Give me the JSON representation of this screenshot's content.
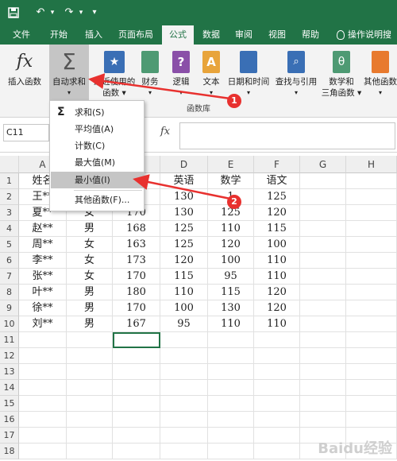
{
  "quick_access": {
    "undo": "↶",
    "redo": "↷",
    "more": "▾"
  },
  "tabs": [
    "文件",
    "开始",
    "插入",
    "页面布局",
    "公式",
    "数据",
    "审阅",
    "视图",
    "帮助"
  ],
  "active_tab": "公式",
  "tell_me": "操作说明搜",
  "ribbon": {
    "insert_function": "插入函数",
    "autosum": "自动求和",
    "recent_line1": "最近使用的",
    "recent_line2": "函数",
    "financial": "财务",
    "logical": "逻辑",
    "text": "文本",
    "datetime": "日期和时间",
    "lookup": "查找与引用",
    "math_line1": "数学和",
    "math_line2": "三角函数",
    "more": "其他函数",
    "group_label": "函数库"
  },
  "formula_bar": {
    "name_box": "C11",
    "fx": "fx"
  },
  "autosum_menu": {
    "items": [
      "求和(S)",
      "平均值(A)",
      "计数(C)",
      "最大值(M)",
      "最小值(I)",
      "其他函数(F)..."
    ],
    "highlighted": "最小值(I)"
  },
  "columns": [
    "A",
    "B",
    "C",
    "D",
    "E",
    "F",
    "G",
    "H"
  ],
  "rows": [
    "1",
    "2",
    "3",
    "4",
    "5",
    "6",
    "7",
    "8",
    "9",
    "10",
    "11",
    "12",
    "13",
    "14",
    "15",
    "16",
    "17",
    "18"
  ],
  "visible_cells": {
    "header": {
      "A": "姓名",
      "D": "英语",
      "E": "数学",
      "F": "语文"
    },
    "r2": {
      "A": "王**",
      "D": "130",
      "E": "1",
      "F": "125"
    },
    "r3": {
      "A": "夏**",
      "B": "女",
      "C": "170",
      "D": "130",
      "E": "125",
      "F": "120"
    },
    "r4": {
      "A": "赵**",
      "B": "男",
      "C": "168",
      "D": "125",
      "E": "110",
      "F": "115"
    },
    "r5": {
      "A": "周**",
      "B": "女",
      "C": "163",
      "D": "125",
      "E": "120",
      "F": "100"
    },
    "r6": {
      "A": "李**",
      "B": "女",
      "C": "173",
      "D": "120",
      "E": "100",
      "F": "110"
    },
    "r7": {
      "A": "张**",
      "B": "女",
      "C": "170",
      "D": "115",
      "E": "95",
      "F": "110"
    },
    "r8": {
      "A": "叶**",
      "B": "男",
      "C": "180",
      "D": "110",
      "E": "115",
      "F": "120"
    },
    "r9": {
      "A": "徐**",
      "B": "男",
      "C": "170",
      "D": "100",
      "E": "130",
      "F": "120"
    },
    "r10": {
      "A": "刘**",
      "B": "男",
      "C": "167",
      "D": "95",
      "E": "110",
      "F": "110"
    }
  },
  "selected_cell": "C11",
  "callouts": [
    "1",
    "2"
  ],
  "watermark": "Baidu经验",
  "colors": {
    "excel_green": "#217346",
    "callout_red": "#e8312f",
    "arrow_red": "#e8312f"
  }
}
